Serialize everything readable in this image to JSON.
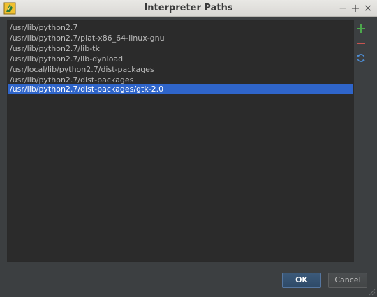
{
  "window": {
    "title": "Interpreter Paths",
    "controls": {
      "minimize": "−",
      "maximize": "+",
      "close": "×"
    }
  },
  "paths": [
    "/usr/lib/python2.7",
    "/usr/lib/python2.7/plat-x86_64-linux-gnu",
    "/usr/lib/python2.7/lib-tk",
    "/usr/lib/python2.7/lib-dynload",
    "/usr/local/lib/python2.7/dist-packages",
    "/usr/lib/python2.7/dist-packages",
    "/usr/lib/python2.7/dist-packages/gtk-2.0"
  ],
  "selected_index": 6,
  "side_buttons": [
    "add-icon",
    "remove-icon",
    "refresh-icon"
  ],
  "buttons": {
    "ok": "OK",
    "cancel": "Cancel"
  },
  "colors": {
    "background": "#3c3f41",
    "list_background": "#2b2b2b",
    "selection": "#2f65ca",
    "add": "#4ca94c",
    "remove": "#c75450",
    "refresh": "#4e8ed6"
  }
}
